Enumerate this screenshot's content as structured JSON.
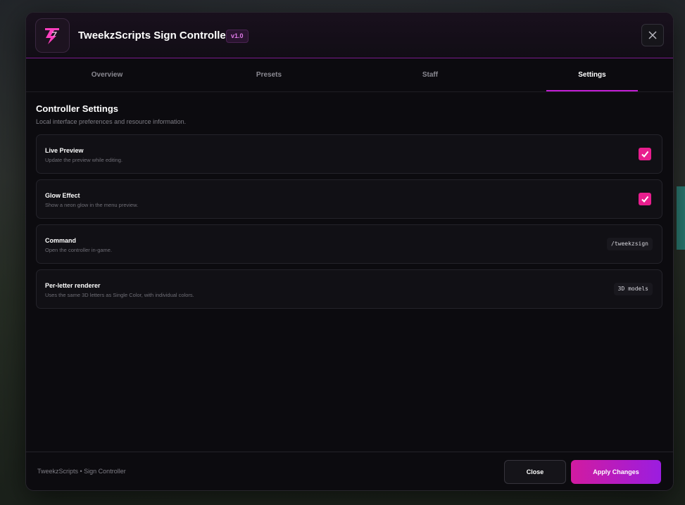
{
  "app": {
    "title": "TweekzScripts Sign Controller",
    "version": "v1.0"
  },
  "tabs": [
    {
      "label": "Overview",
      "active": false
    },
    {
      "label": "Presets",
      "active": false
    },
    {
      "label": "Staff",
      "active": false
    },
    {
      "label": "Settings",
      "active": true
    }
  ],
  "section": {
    "title": "Controller Settings",
    "subtitle": "Local interface preferences and resource information."
  },
  "settings": [
    {
      "label": "Live Preview",
      "description": "Update the preview while editing.",
      "type": "checkbox",
      "checked": true
    },
    {
      "label": "Glow Effect",
      "description": "Show a neon glow in the menu preview.",
      "type": "checkbox",
      "checked": true
    },
    {
      "label": "Command",
      "description": "Open the controller in-game.",
      "type": "code",
      "value": "/tweekzsign"
    },
    {
      "label": "Per-letter renderer",
      "description": "Uses the same 3D letters as Single Color, with individual colors.",
      "type": "code",
      "value": "3D models"
    }
  ],
  "footer": {
    "text": "TweekzScripts • Sign Controller",
    "close_label": "Close",
    "apply_label": "Apply Changes"
  },
  "colors": {
    "accent": "#c21ed4",
    "checkbox": "#e81e8e",
    "background": "#0c0b0f"
  },
  "icons": {
    "logo": "lightning-logo-icon",
    "close": "close-icon",
    "check": "checkmark-icon"
  }
}
